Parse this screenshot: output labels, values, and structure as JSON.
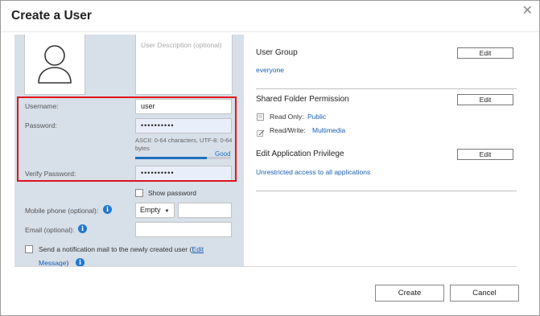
{
  "dialog": {
    "title": "Create a User"
  },
  "profile": {
    "description_placeholder": "User Description (optional)"
  },
  "form": {
    "username_label": "Username:",
    "username_value": "user",
    "password_label": "Password:",
    "password_value": "••••••••••",
    "password_hint": "ASCII: 0-64 characters, UTF-8: 0-64 bytes",
    "strength_label": "Good",
    "strength_level": 0.75,
    "verify_label": "Verify Password:",
    "verify_value": "••••••••••",
    "show_password_label": "Show password",
    "mobile_label": "Mobile phone (optional):",
    "mobile_country": "Empty",
    "email_label": "Email (optional):",
    "notify_text": "Send a notification mail to the newly created user (",
    "notify_link_1": "Edit",
    "notify_link_2": "Message",
    "notify_close": ")"
  },
  "right": {
    "user_group": {
      "title": "User Group",
      "edit": "Edit",
      "value": "everyone"
    },
    "shared_folder": {
      "title": "Shared Folder Permission",
      "edit": "Edit",
      "read_only_label": "Read Only:",
      "read_only_value": "Public",
      "read_write_label": "Read/Write:",
      "read_write_value": "Multimedia"
    },
    "app_privilege": {
      "title": "Edit Application Privilege",
      "edit": "Edit",
      "value": "Unrestricted access to all applications"
    }
  },
  "footer": {
    "create": "Create",
    "cancel": "Cancel"
  },
  "icons": {
    "close": "close-icon",
    "avatar": "user-avatar-icon",
    "info": "info-icon"
  },
  "colors": {
    "accent": "#1e78d0",
    "link": "#1a5fb4",
    "highlight": "#e0141c",
    "panel": "#d7dfe8"
  }
}
